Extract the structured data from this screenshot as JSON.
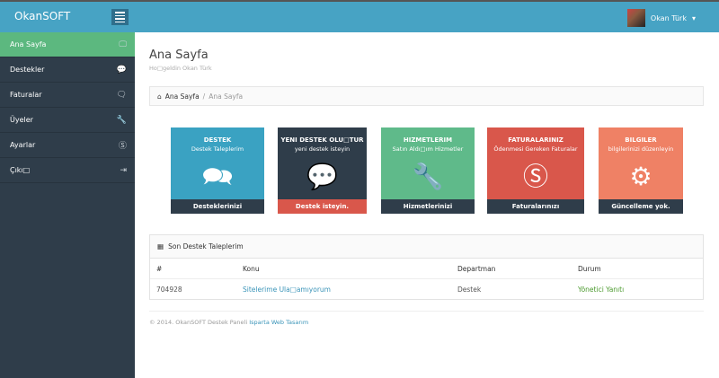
{
  "header": {
    "brand": "OkanSOFT",
    "user_name": "Okan Türk",
    "caret": "▾"
  },
  "sidebar": {
    "items": [
      {
        "label": "Ana Sayfa",
        "icon": "🖵"
      },
      {
        "label": "Destekler",
        "icon": "💬"
      },
      {
        "label": "Faturalar",
        "icon": "🗨"
      },
      {
        "label": "Üyeler",
        "icon": "🔧"
      },
      {
        "label": "Ayarlar",
        "icon": "Ⓢ"
      },
      {
        "label": "Çıkı□",
        "icon": "⇥"
      }
    ]
  },
  "page": {
    "title": "Ana Sayfa",
    "subtitle": "Ho□geldin Okan Türk"
  },
  "breadcrumb": {
    "home": "Ana Sayfa",
    "sep": "/",
    "current": "Ana Sayfa"
  },
  "tiles": [
    {
      "title": "DESTEK",
      "subtitle": "Destek Taleplerim",
      "icon": "🗪",
      "footer": "Desteklerinizi Görüntüleyin..",
      "color": "#3aa2c2",
      "footer_color": "#2f3d4a"
    },
    {
      "title": "YENI DESTEK OLU□TUR",
      "subtitle": "yeni destek isteyin",
      "icon": "💬",
      "footer": "Destek isteyin.",
      "color": "#2f3d4a",
      "footer_color": "#d9574b"
    },
    {
      "title": "HIZMETLERIM",
      "subtitle": "Satın Aldı□ım Hizmetler",
      "icon": "🔧",
      "footer": "Hizmetlerinizi Görüntüleyin.",
      "color": "#5fba8a",
      "footer_color": "#2f3d4a"
    },
    {
      "title": "FATURALARINIZ",
      "subtitle": "Ödenmesi Gereken Faturalar",
      "icon": "Ⓢ",
      "footer": "Faturalarınızı Görüntüleyin.",
      "color": "#d9574b",
      "footer_color": "#2f3d4a"
    },
    {
      "title": "BILGILER",
      "subtitle": "bilgilerinizi düzenleyin",
      "icon": "⚙",
      "footer": "Güncelleme yok.",
      "color": "#ef8165",
      "footer_color": "#2f3d4a"
    }
  ],
  "table": {
    "title": "Son Destek Taleplerim",
    "columns": [
      "#",
      "Konu",
      "Departman",
      "Durum"
    ],
    "rows": [
      {
        "id": "704928",
        "konu": "Sitelerime Ula□amıyorum",
        "departman": "Destek",
        "durum": "Yönetici Yanıtı"
      }
    ]
  },
  "footer": {
    "text": "© 2014. OkanSOFT Destek Paneli",
    "link": "Isparta Web Tasarım"
  }
}
